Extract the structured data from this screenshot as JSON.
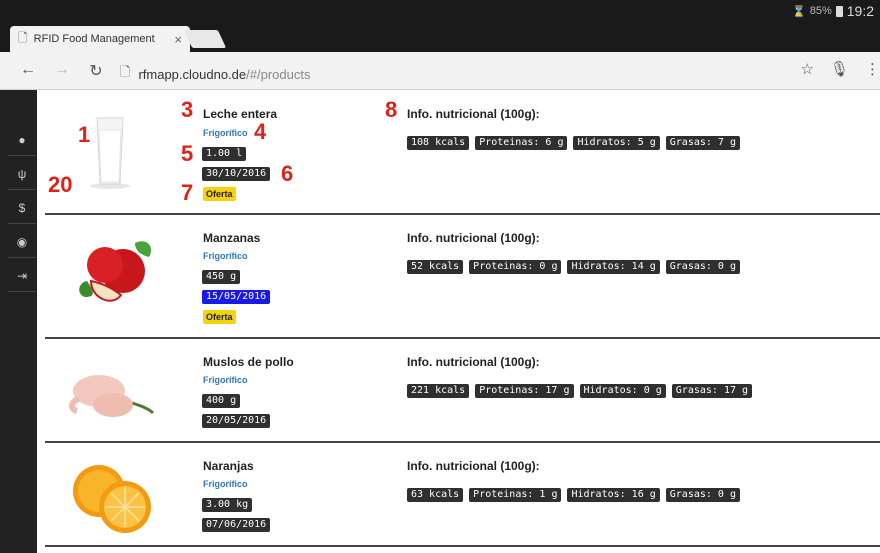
{
  "status_bar": {
    "battery": "85%",
    "time": "19:2"
  },
  "tab": {
    "title": "RFID Food Management",
    "close": "×"
  },
  "address_bar": {
    "host": "rfmapp.cloudno.de",
    "path": "/#/products"
  },
  "products": [
    {
      "name": "Leche entera",
      "location": "Frigorífico",
      "quantity": "1.00 l",
      "date": "30/10/2016",
      "offer": "Oferta",
      "nutri_title": "Info. nutricional (100g):",
      "kcals": "108 kcals",
      "proteins": "Proteinas: 6 g",
      "carbs": "Hidratos: 5 g",
      "fats": "Grasas: 7 g"
    },
    {
      "name": "Manzanas",
      "location": "Frigorífico",
      "quantity": "450 g",
      "date": "15/05/2016",
      "offer": "Oferta",
      "nutri_title": "Info. nutricional (100g):",
      "kcals": "52 kcals",
      "proteins": "Proteinas: 0 g",
      "carbs": "Hidratos: 14 g",
      "fats": "Grasas: 0 g"
    },
    {
      "name": "Muslos de pollo",
      "location": "Frigorífico",
      "quantity": "400 g",
      "date": "20/05/2016",
      "nutri_title": "Info. nutricional (100g):",
      "kcals": "221 kcals",
      "proteins": "Proteinas: 17 g",
      "carbs": "Hidratos: 0 g",
      "fats": "Grasas: 17 g"
    },
    {
      "name": "Naranjas",
      "location": "Frigorífico",
      "quantity": "3.00 kg",
      "date": "07/06/2016",
      "nutri_title": "Info. nutricional (100g):",
      "kcals": "63 kcals",
      "proteins": "Proteinas: 1 g",
      "carbs": "Hidratos: 16 g",
      "fats": "Grasas: 0 g"
    }
  ],
  "annotations": [
    "1",
    "20",
    "3",
    "4",
    "5",
    "6",
    "7",
    "8"
  ]
}
